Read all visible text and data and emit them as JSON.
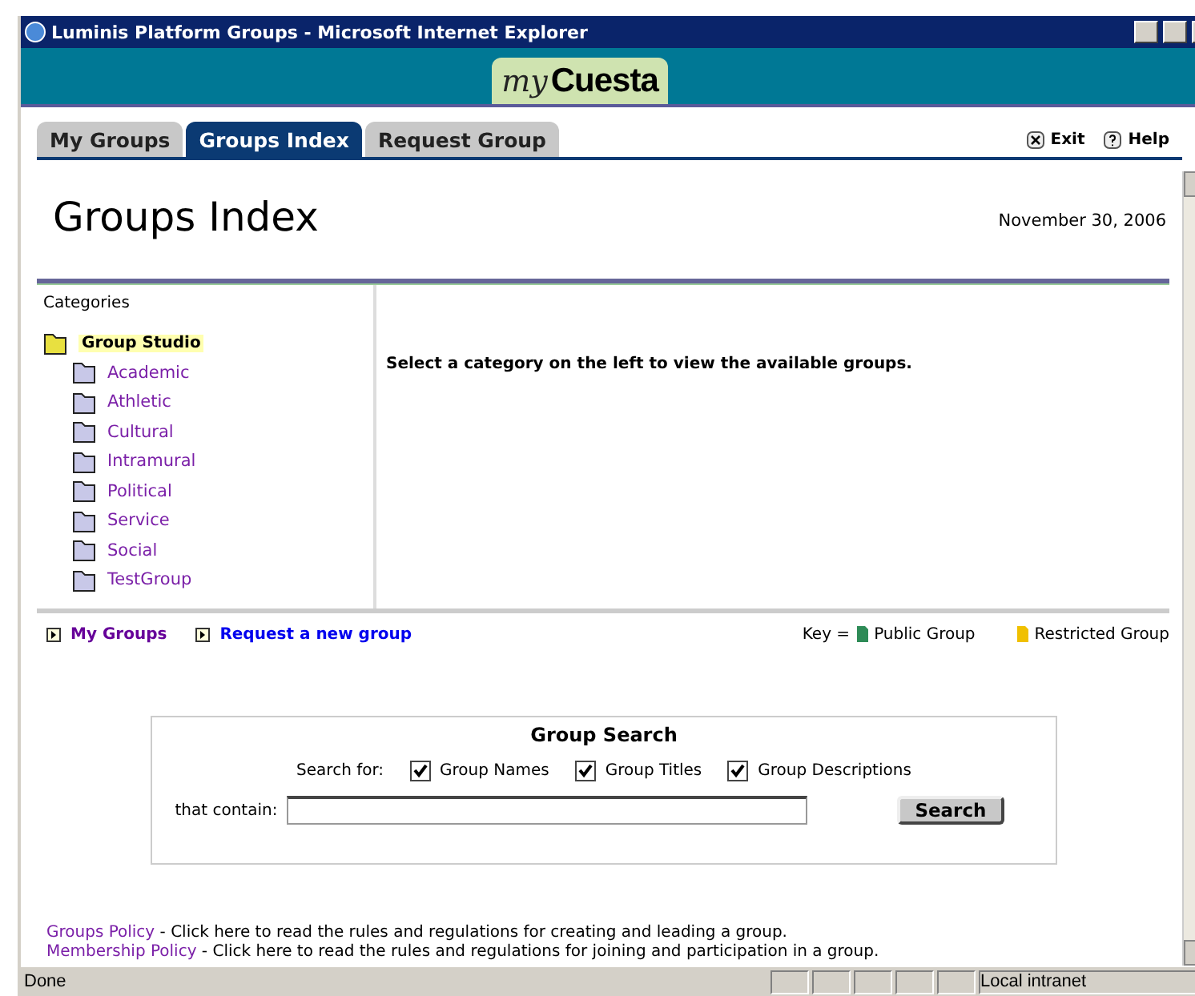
{
  "window": {
    "title": "Luminis Platform Groups - Microsoft Internet Explorer"
  },
  "banner": {
    "logo_script": "my",
    "logo_bold": "Cuesta"
  },
  "tabs": [
    {
      "label": "My Groups",
      "selected": false
    },
    {
      "label": "Groups Index",
      "selected": true
    },
    {
      "label": "Request Group",
      "selected": false
    }
  ],
  "top_links": [
    {
      "label": "Exit",
      "kind": "exit"
    },
    {
      "label": "Help",
      "kind": "help"
    }
  ],
  "heading": "Groups Index",
  "date": "November 30, 2006",
  "categories": {
    "label": "Categories",
    "root": {
      "label": "Group Studio",
      "children": [
        {
          "label": "Academic"
        },
        {
          "label": "Athletic"
        },
        {
          "label": "Cultural"
        },
        {
          "label": "Intramural"
        },
        {
          "label": "Political"
        },
        {
          "label": "Service"
        },
        {
          "label": "Social"
        },
        {
          "label": "TestGroup"
        }
      ]
    }
  },
  "message": "Select a category on the left to view the available groups.",
  "bottom_links": [
    {
      "label": "My Groups",
      "color": "#660099"
    },
    {
      "label": "Request a new group",
      "color": "#0000ee"
    }
  ],
  "key": {
    "label": "Key =",
    "items": [
      {
        "label": "Public Group",
        "color": "#2e8b57"
      },
      {
        "label": "Restricted Group",
        "color": "#f0c000"
      }
    ]
  },
  "search": {
    "title": "Group Search",
    "for_label": "Search for:",
    "options": [
      {
        "label": "Group Names",
        "checked": true
      },
      {
        "label": "Group Titles",
        "checked": true
      },
      {
        "label": "Group Descriptions",
        "checked": true
      }
    ],
    "contain_label": "that contain:",
    "button": "Search"
  },
  "policies": [
    {
      "link": "Groups Policy",
      "text": " - Click here to read the rules and regulations for creating and leading a group."
    },
    {
      "link": "Membership Policy",
      "text": " - Click here to read the rules and regulations for joining and participation in a group."
    }
  ],
  "status_bar": {
    "text": "Done",
    "zone": "Local intranet"
  }
}
